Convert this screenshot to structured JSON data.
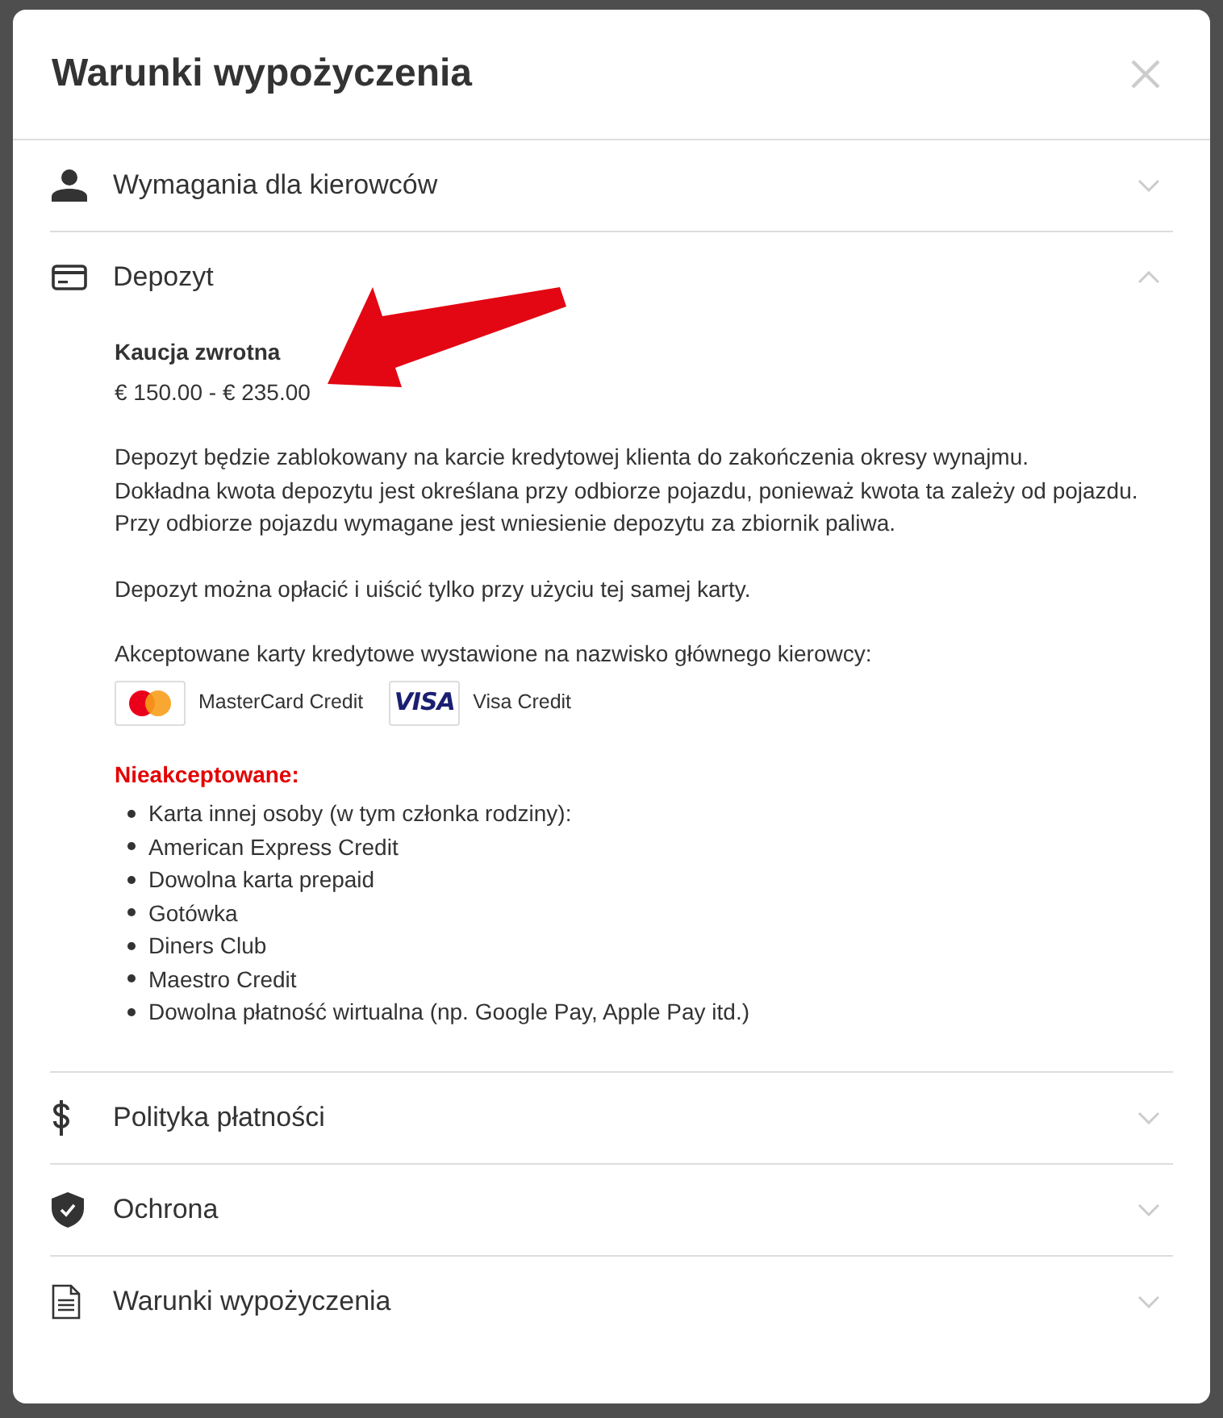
{
  "dialog": {
    "title": "Warunki wypożyczenia"
  },
  "sections": [
    {
      "kind": "person",
      "title": "Wymagania dla kierowców",
      "expanded": false
    },
    {
      "kind": "card",
      "title": "Depozyt",
      "expanded": true,
      "content": {
        "deposit_label": "Kaucja zwrotna",
        "deposit_range": "€ 150.00 - € 235.00",
        "paragraphs": [
          [
            "Depozyt będzie zablokowany na karcie kredytowej klienta do zakończenia okresy wynajmu.",
            "Dokładna kwota depozytu jest określana przy odbiorze pojazdu, ponieważ kwota ta zależy od pojazdu.",
            "Przy odbiorze pojazdu wymagane jest wniesienie depozytu za zbiornik paliwa."
          ],
          [
            "Depozyt można opłacić i uiścić tylko przy użyciu tej samej karty."
          ],
          [
            "Akceptowane karty kredytowe wystawione na nazwisko głównego kierowcy:"
          ]
        ],
        "accepted_cards": [
          {
            "kind": "mastercard",
            "name": "MasterCard Credit"
          },
          {
            "kind": "visa",
            "logo_text": "VISA",
            "name": "Visa Credit"
          }
        ],
        "not_accepted_title": "Nieakceptowane:",
        "not_accepted": [
          "Karta innej osoby (w tym członka rodziny):",
          "American Express Credit",
          "Dowolna karta prepaid",
          "Gotówka",
          "Diners Club",
          "Maestro Credit",
          "Dowolna płatność wirtualna (np. Google Pay, Apple Pay itd.)"
        ]
      }
    },
    {
      "kind": "dollar",
      "title": "Polityka płatności",
      "expanded": false
    },
    {
      "kind": "shield",
      "title": "Ochrona",
      "expanded": false
    },
    {
      "kind": "document",
      "title": "Warunki wypożyczenia",
      "expanded": false
    }
  ]
}
